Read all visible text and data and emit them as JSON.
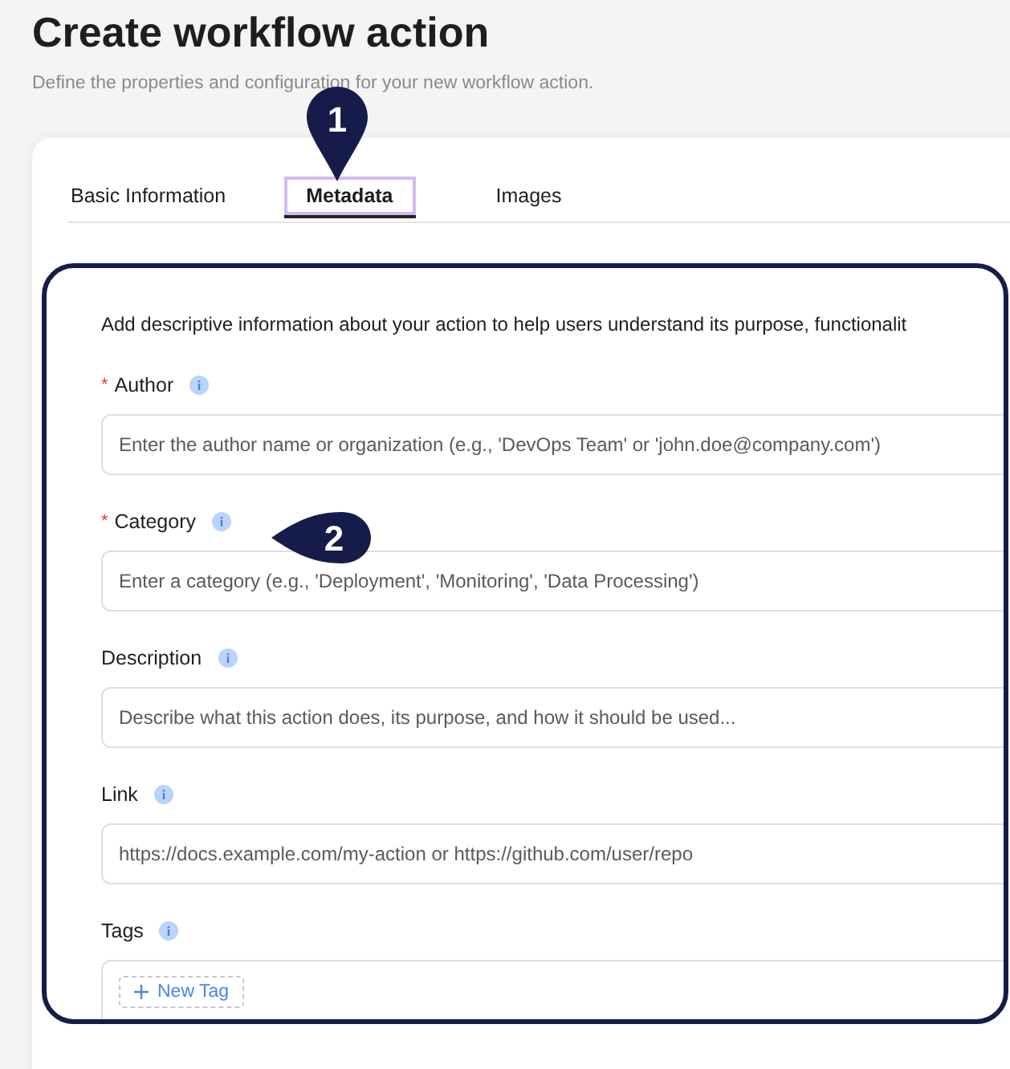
{
  "page": {
    "title": "Create workflow action",
    "subtitle": "Define the properties and configuration for your new workflow action."
  },
  "tabs": [
    {
      "label": "Basic Information",
      "selected": false
    },
    {
      "label": "Metadata",
      "selected": true
    },
    {
      "label": "Images",
      "selected": false
    }
  ],
  "panel": {
    "intro": "Add descriptive information about your action to help users understand its purpose, functionalit",
    "fields": [
      {
        "kind": "input",
        "label": "Author",
        "required_mark": "*",
        "placeholder": "Enter the author name or organization (e.g., 'DevOps Team' or 'john.doe@company.com')"
      },
      {
        "kind": "input",
        "label": "Category",
        "required_mark": "*",
        "placeholder": "Enter a category (e.g., 'Deployment', 'Monitoring', 'Data Processing')"
      },
      {
        "kind": "input",
        "label": "Description",
        "placeholder": "Describe what this action does, its purpose, and how it should be used..."
      },
      {
        "kind": "input",
        "label": "Link",
        "placeholder": "https://docs.example.com/my-action or https://github.com/user/repo"
      },
      {
        "kind": "tags",
        "label": "Tags",
        "add_button": "New Tag"
      }
    ]
  },
  "callouts": [
    {
      "kind": "pin",
      "number": "1"
    },
    {
      "kind": "pointer",
      "number": "2"
    }
  ]
}
